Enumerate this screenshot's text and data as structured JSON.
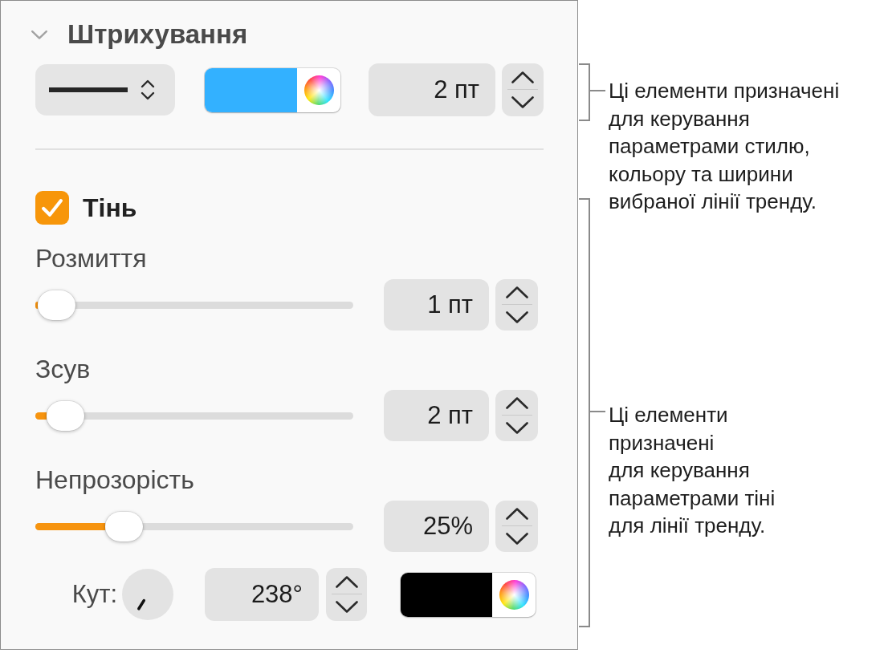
{
  "stroke": {
    "title": "Штрихування",
    "expanded": true,
    "color": "#33b1ff",
    "width": "2 пт"
  },
  "shadow": {
    "label": "Тінь",
    "checked": true,
    "sliders": [
      {
        "label": "Розмиття",
        "level": 0.01,
        "value": "1 пт"
      },
      {
        "label": "Зсув",
        "level": 0.04,
        "value": "2 пт"
      },
      {
        "label": "Непрозорість",
        "level": 0.25,
        "value": "25%"
      }
    ],
    "angle": {
      "label": "Кут:",
      "value": "238°"
    },
    "color": "#000000"
  },
  "callouts": [
    {
      "text": "Ці елементи призначені\nдля керування\nпараметрами стилю,\nкольору та ширини\nвибраної лінії тренду."
    },
    {
      "text": "Ці елементи\nпризначені\nдля керування\nпараметрами тіні\nдля лінії тренду."
    }
  ]
}
